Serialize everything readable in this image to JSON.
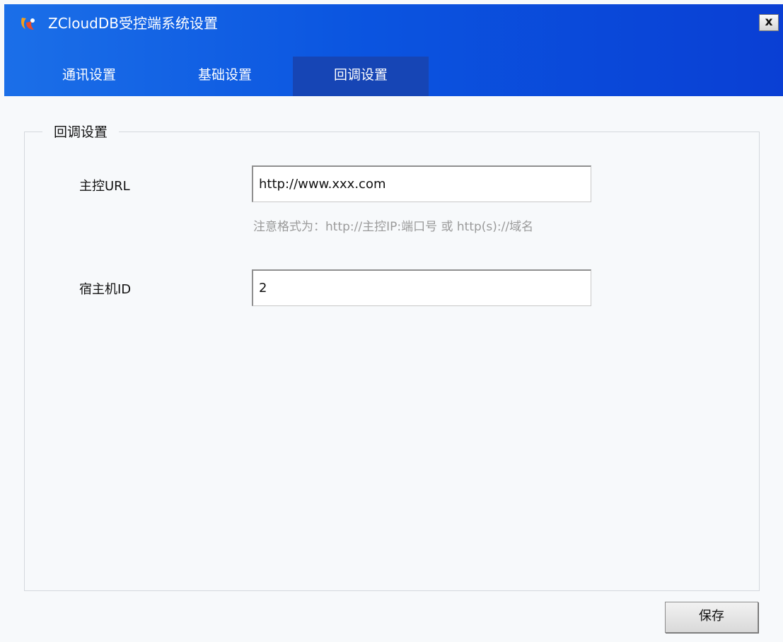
{
  "window": {
    "title": "ZCloudDB受控端系统设置",
    "close_label": "x",
    "icon": "app-logo-icon"
  },
  "tabs": [
    {
      "label": "通讯设置",
      "active": false
    },
    {
      "label": "基础设置",
      "active": false
    },
    {
      "label": "回调设置",
      "active": true
    }
  ],
  "callback": {
    "group_title": "回调设置",
    "master_url_label": "主控URL",
    "master_url_value": "http://www.xxx.com",
    "hint": "注意格式为：http://主控IP:端口号 或 http(s)://域名",
    "host_id_label": "宿主机ID",
    "host_id_value": "2"
  },
  "actions": {
    "save_label": "保存"
  },
  "colors": {
    "header_blue": "#0b55e0",
    "active_tab": "#1645b5",
    "hint_gray": "#9a9a9a"
  }
}
